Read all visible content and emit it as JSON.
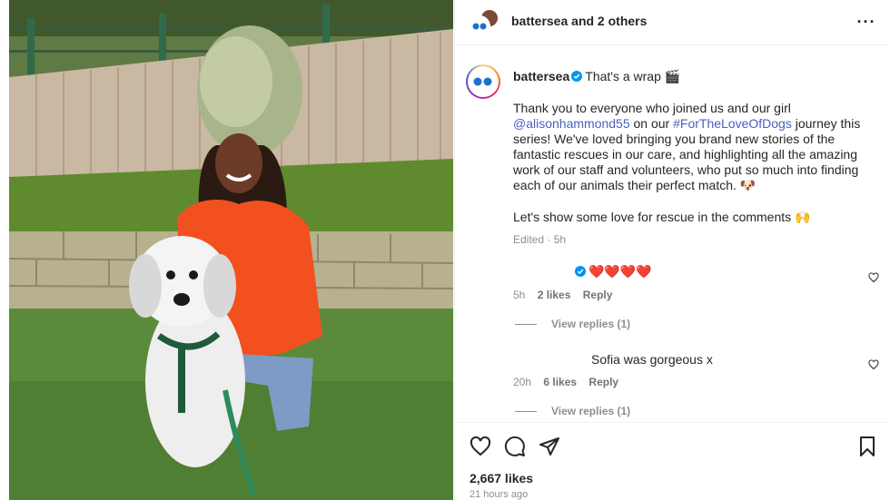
{
  "header": {
    "account": "battersea",
    "others": "and 2 others"
  },
  "caption": {
    "username": "battersea",
    "headline": "That's a wrap 🎬",
    "para1_start": "Thank you to everyone who joined us and our girl ",
    "mention": "@alisonhammond55",
    "para1_mid": " on our ",
    "hashtag": "#ForTheLoveOfDogs",
    "para1_end": " journey this series! We've loved bringing you brand new stories of the fantastic rescues in our care, and highlighting all the amazing work of our staff and volunteers, who put so much into finding each of our animals their perfect match. 🐶",
    "para2": "Let's show some love for rescue in the comments 🙌",
    "meta": "Edited · 5h"
  },
  "comments": [
    {
      "text": "❤️❤️❤️❤️",
      "time": "5h",
      "likes": "2 likes",
      "reply": "Reply",
      "view_replies": "View replies (1)"
    },
    {
      "text": "Sofia was gorgeous x",
      "time": "20h",
      "likes": "6 likes",
      "reply": "Reply",
      "view_replies": "View replies (1)"
    }
  ],
  "post": {
    "likes": "2,667 likes",
    "time": "21 hours ago"
  },
  "icons": {
    "like": "heart-icon",
    "comment": "comment-icon",
    "share": "share-icon",
    "save": "bookmark-icon",
    "more": "more-icon",
    "verified": "verified-badge-icon"
  },
  "colors": {
    "verified": "#0095f6",
    "link": "#4a5fc1",
    "heart": "#ed1b2e",
    "muted": "#8e8e8e"
  }
}
